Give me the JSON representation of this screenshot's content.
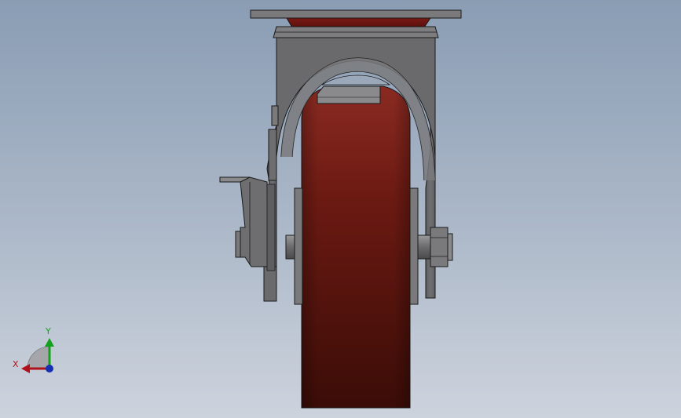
{
  "viewport": {
    "model": "caster-wheel-assembly",
    "view": "front"
  },
  "colors": {
    "background_top": "#8a9db4",
    "background_bottom": "#cdd3dd",
    "wheel": "#6e1a12",
    "wheel_dark": "#3e0d08",
    "metal": "#6a6a6c",
    "metal_light": "#8a8a8c",
    "edge": "#1a1a1a",
    "triad_x": "#b0121b",
    "triad_y": "#14a01e",
    "triad_z": "#1530b0"
  },
  "triad": {
    "x_label": "X",
    "y_label": "Y"
  }
}
